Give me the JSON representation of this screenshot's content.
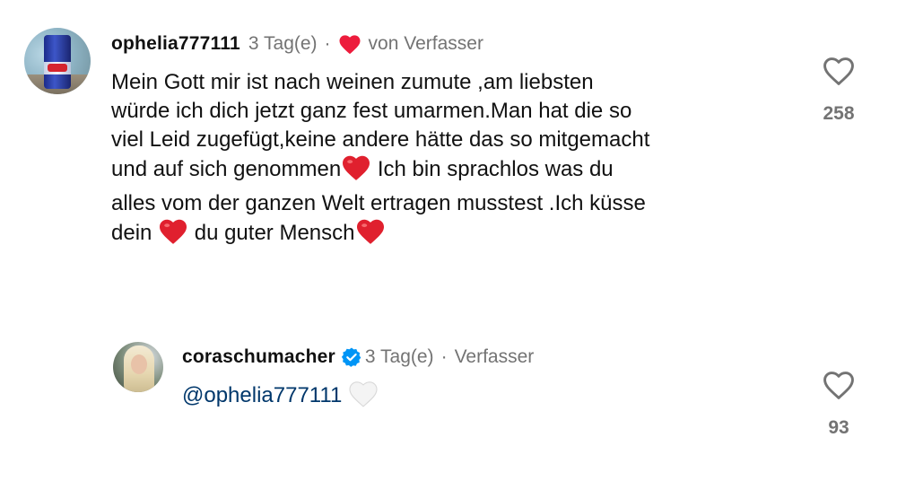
{
  "comments": [
    {
      "username": "ophelia777111",
      "time": "3 Tag(e)",
      "separator": "·",
      "liked_by_author_label": "von Verfasser",
      "text_lines": [
        "Mein Gott mir ist nach weinen zumute ,am liebsten",
        "würde ich dich jetzt ganz fest umarmen.Man hat die so",
        "viel Leid zugefügt,keine andere hätte das so mitgemacht",
        "und auf sich genommen",
        "Ich bin sprachlos was du",
        "alles vom der ganzen Welt ertragen musstest .Ich küsse",
        "dein",
        "du guter Mensch"
      ],
      "like_count": "258",
      "like_icon": "heart-outline-icon",
      "author_heart_color": "#ed1c3c"
    },
    {
      "username": "coraschumacher",
      "verified": true,
      "time": "3 Tag(e)",
      "separator": "·",
      "author_label": "Verfasser",
      "mention": "@ophelia777111",
      "like_count": "93",
      "like_icon": "heart-outline-icon",
      "verified_color": "#0095f6"
    }
  ],
  "colors": {
    "secondary_text": "#737373",
    "mention": "#00376b",
    "red_heart": "#e0202e"
  }
}
